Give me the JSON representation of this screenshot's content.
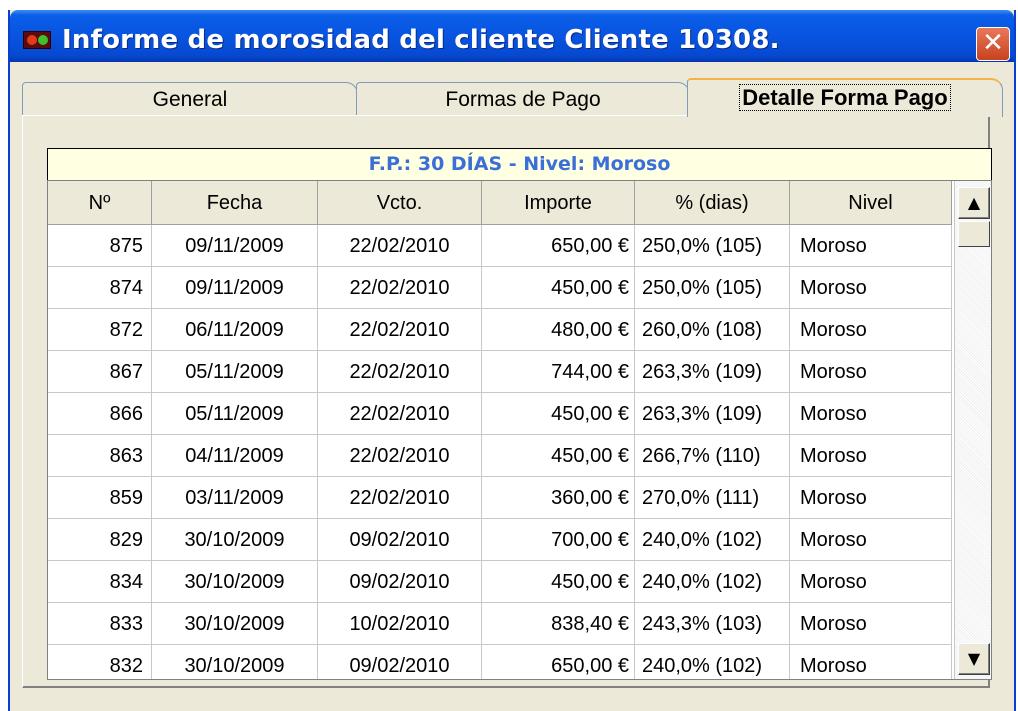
{
  "window": {
    "title": "Informe de morosidad del cliente Cliente 10308.",
    "close_glyph": "✕"
  },
  "tabs": [
    {
      "label": "General",
      "selected": false
    },
    {
      "label": "Formas de Pago",
      "selected": false
    },
    {
      "label": "Detalle Forma Pago",
      "selected": true
    }
  ],
  "detail": {
    "header": "F.P.: 30 DÍAS - Nivel: Moroso"
  },
  "table": {
    "columns": [
      "Nº",
      "Fecha",
      "Vcto.",
      "Importe",
      "% (dias)",
      "Nivel"
    ],
    "rows": [
      [
        "875",
        "09/11/2009",
        "22/02/2010",
        "650,00 €",
        "250,0% (105)",
        "Moroso"
      ],
      [
        "874",
        "09/11/2009",
        "22/02/2010",
        "450,00 €",
        "250,0% (105)",
        "Moroso"
      ],
      [
        "872",
        "06/11/2009",
        "22/02/2010",
        "480,00 €",
        "260,0% (108)",
        "Moroso"
      ],
      [
        "867",
        "05/11/2009",
        "22/02/2010",
        "744,00 €",
        "263,3% (109)",
        "Moroso"
      ],
      [
        "866",
        "05/11/2009",
        "22/02/2010",
        "450,00 €",
        "263,3% (109)",
        "Moroso"
      ],
      [
        "863",
        "04/11/2009",
        "22/02/2010",
        "450,00 €",
        "266,7% (110)",
        "Moroso"
      ],
      [
        "859",
        "03/11/2009",
        "22/02/2010",
        "360,00 €",
        "270,0% (111)",
        "Moroso"
      ],
      [
        "829",
        "30/10/2009",
        "09/02/2010",
        "700,00 €",
        "240,0% (102)",
        "Moroso"
      ],
      [
        "834",
        "30/10/2009",
        "09/02/2010",
        "450,00 €",
        "240,0% (102)",
        "Moroso"
      ],
      [
        "833",
        "30/10/2009",
        "10/02/2010",
        "838,40 €",
        "243,3% (103)",
        "Moroso"
      ],
      [
        "832",
        "30/10/2009",
        "09/02/2010",
        "650,00 €",
        "240,0% (102)",
        "Moroso"
      ]
    ]
  },
  "scrollbar": {
    "up_glyph": "▲",
    "down_glyph": "▼",
    "position": 0
  },
  "colors": {
    "titlebar": "#0854e0",
    "header_text": "#3a6fd8",
    "header_bg": "#ffffe1"
  }
}
